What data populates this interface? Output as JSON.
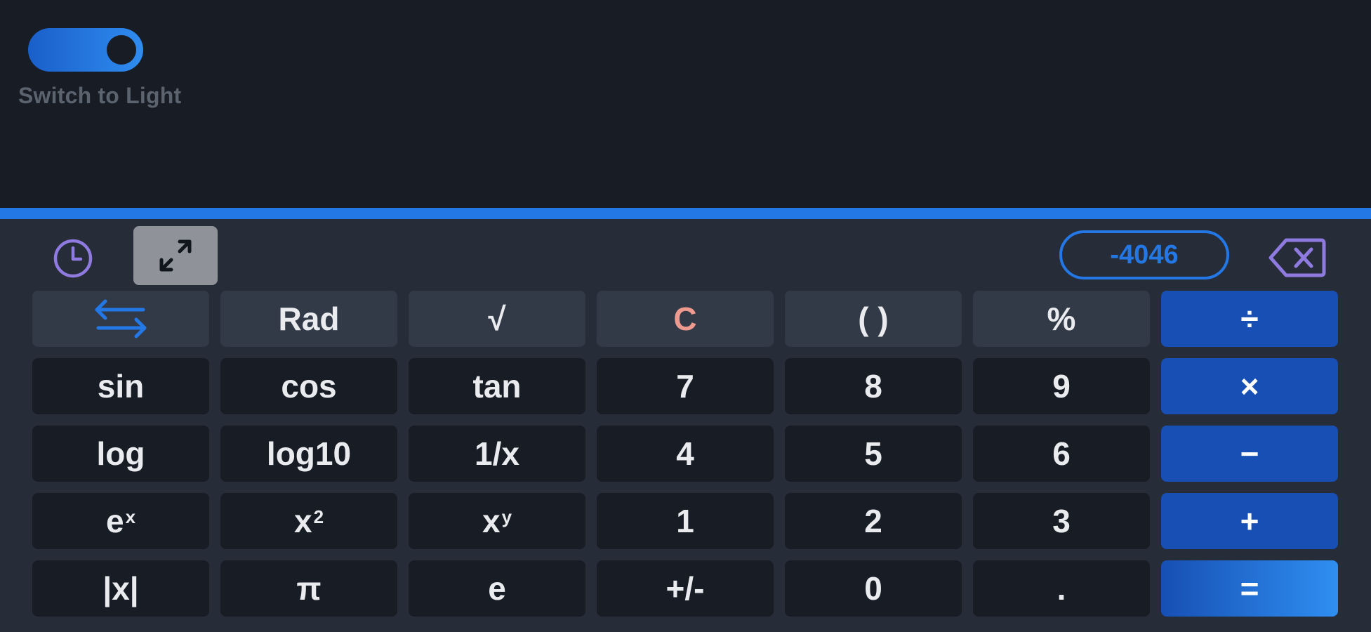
{
  "theme": {
    "toggle_label": "Switch to Light"
  },
  "toolbar": {
    "history_icon": "clock-icon",
    "expand_icon": "expand-arrows-icon",
    "result": "-4046",
    "backspace_icon": "backspace-icon"
  },
  "keys": {
    "row1": [
      "⇆",
      "Rad",
      "√",
      "C",
      "( )",
      "%",
      "÷"
    ],
    "row2": [
      "sin",
      "cos",
      "tan",
      "7",
      "8",
      "9",
      "×"
    ],
    "row3": [
      "log",
      "log10",
      "1/x",
      "4",
      "5",
      "6",
      "−"
    ],
    "row4": {
      "exp_base": "e",
      "exp_power": "x",
      "sq_base": "x",
      "sq_power": "2",
      "pow_base": "x",
      "pow_power": "y",
      "d1": "1",
      "d2": "2",
      "d3": "3",
      "plus": "+"
    },
    "row5": [
      "|x|",
      "π",
      "e",
      "+/-",
      "0",
      ".",
      "="
    ]
  },
  "colors": {
    "accent": "#2378e6",
    "operator": "#174fb4",
    "clear": "#ee9a8e",
    "icon": "#8f7ae0"
  }
}
